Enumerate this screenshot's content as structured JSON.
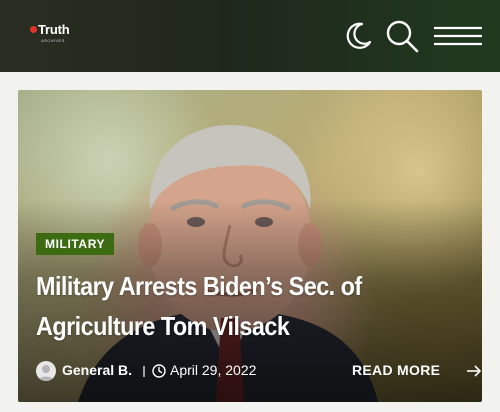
{
  "header": {
    "logo_text": "Truth",
    "logo_subtext": "ARCHIVES",
    "icons": [
      "moon-icon",
      "search-icon",
      "hamburger-menu-icon"
    ]
  },
  "article": {
    "category": "MILITARY",
    "title": "Military Arrests Biden’s Sec. of Agriculture Tom Vilsack",
    "author": "General B.",
    "date": "April 29, 2022",
    "read_more": "READ MORE"
  },
  "colors": {
    "header_bg": "#1f271c",
    "accent_green": "#3d6b12",
    "logo_red": "#e2332b"
  }
}
